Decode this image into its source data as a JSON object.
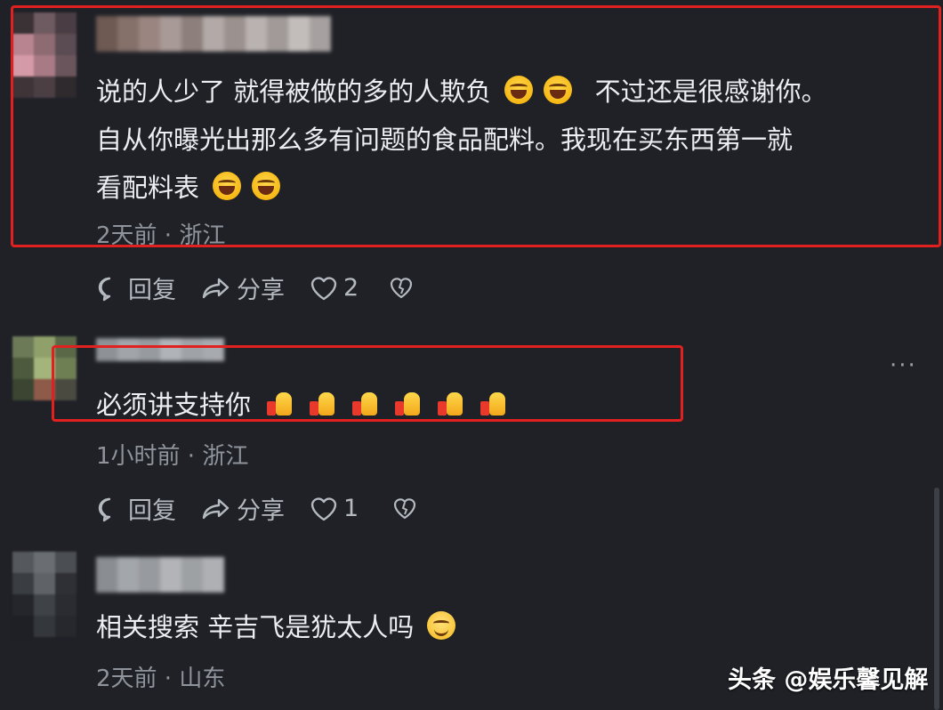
{
  "comments": [
    {
      "lines": [
        "说的人少了 就得被做的多的人欺负",
        "不过还是很感谢你。",
        "自从你曝光出那么多有问题的食品配料。我现在买东西第一就",
        "看配料表"
      ],
      "meta": "2天前 · 浙江",
      "reply_label": "回复",
      "share_label": "分享",
      "like_count": "2"
    },
    {
      "lines": [
        "必须讲支持你"
      ],
      "meta": "1小时前 · 浙江",
      "reply_label": "回复",
      "share_label": "分享",
      "like_count": "1"
    },
    {
      "lines": [
        "相关搜索 辛吉飞是犹太人吗"
      ],
      "meta": "2天前 · 山东"
    }
  ],
  "more_menu_label": "···",
  "watermark": "头条 @娱乐馨见解",
  "colors": {
    "background": "#1f2127",
    "highlight": "#e0211f",
    "meta_text": "#8f949c"
  },
  "icons": [
    "comment-bubble-icon",
    "share-arrow-icon",
    "heart-icon",
    "broken-heart-icon",
    "laughing-emoji-icon",
    "thumbs-up-emoji-icon",
    "smile-emoji-icon"
  ]
}
